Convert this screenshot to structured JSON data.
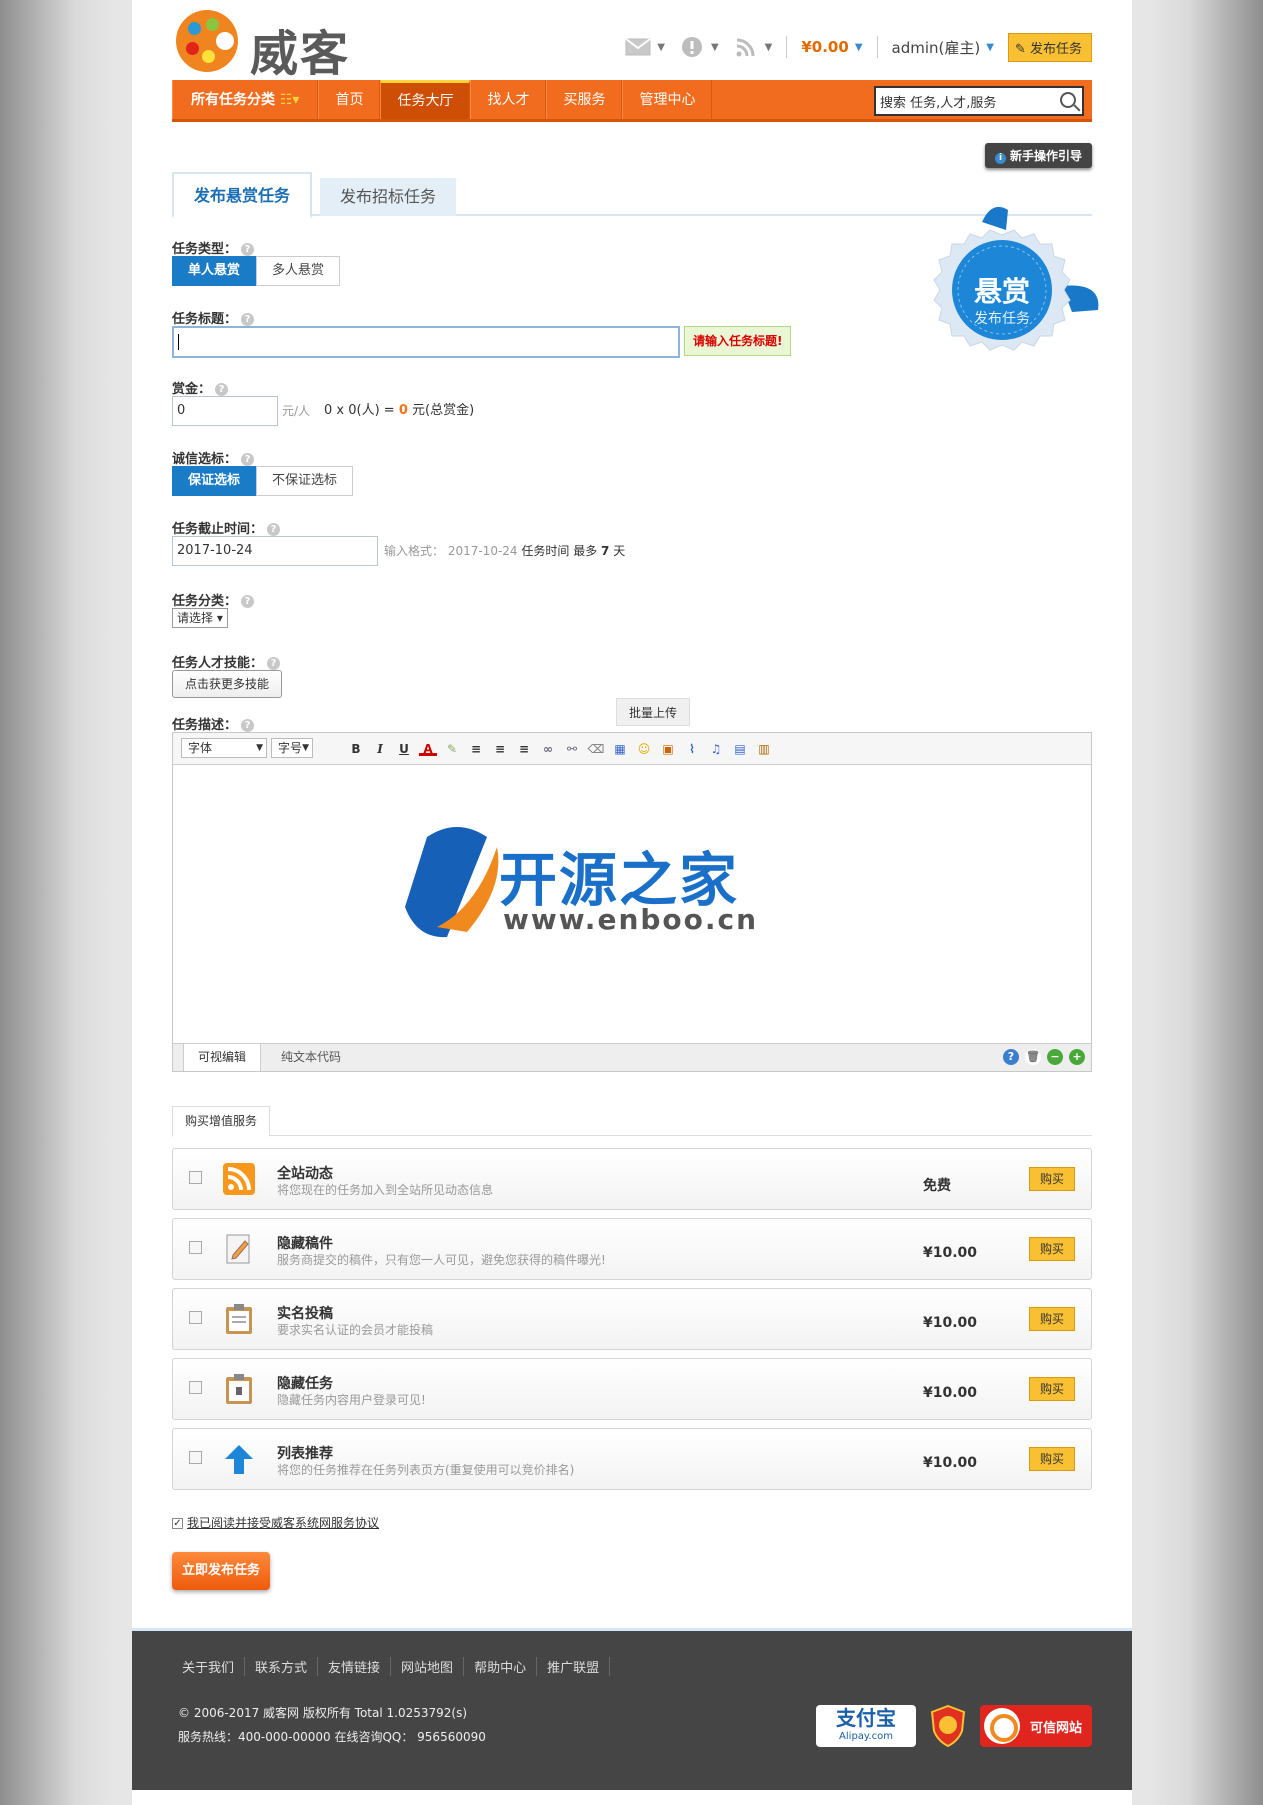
{
  "header": {
    "logo_text": "威客",
    "balance": "¥0.00",
    "user": "admin(雇主)",
    "post_task": "发布任务"
  },
  "nav": {
    "items": [
      "所有任务分类",
      "首页",
      "任务大厅",
      "找人才",
      "买服务",
      "管理中心"
    ],
    "active_index": 2,
    "search_value": "搜索 任务,人才,服务"
  },
  "guide_button": "新手操作引导",
  "tabs": [
    "发布悬赏任务",
    "发布招标任务"
  ],
  "badge": {
    "title": "悬赏",
    "subtitle": "发布任务"
  },
  "form": {
    "task_type": {
      "label": "任务类型：",
      "options": [
        "单人悬赏",
        "多人悬赏"
      ],
      "selected": 0
    },
    "title": {
      "label": "任务标题：",
      "value": "",
      "error": "请输入任务标题!"
    },
    "bounty": {
      "label": "赏金：",
      "value": "0",
      "unit": "元/人",
      "formula_pre": "0 x 0(人) = ",
      "formula_total": "0",
      "formula_post": " 元(总赏金)"
    },
    "bid": {
      "label": "诚信选标：",
      "options": [
        "保证选标",
        "不保证选标"
      ],
      "selected": 0
    },
    "deadline": {
      "label": "任务截止时间：",
      "value": "2017-10-24",
      "hint_pre": "输入格式：  2017-10-24",
      "hint_mid": " 任务时间 最多 ",
      "hint_days": "7",
      "hint_post": " 天"
    },
    "category": {
      "label": "任务分类：",
      "value": "请选择"
    },
    "skills": {
      "label": "任务人才技能：",
      "button": "点击获更多技能"
    },
    "description": {
      "label": "任务描述：",
      "batch_upload": "批量上传",
      "font": "字体",
      "size": "字号",
      "tab_visual": "可视编辑",
      "tab_source": "纯文本代码"
    }
  },
  "watermark": {
    "title": "开源之家",
    "url": "www.enboo.cn"
  },
  "value_added": {
    "tab": "购买增值服务",
    "buy_label": "购买",
    "items": [
      {
        "name": "全站动态",
        "desc": "将您现在的任务加入到全站所见动态信息",
        "price": "免费",
        "icon": "rss-icon"
      },
      {
        "name": "隐藏稿件",
        "desc": "服务商提交的稿件，只有您一人可见，避免您获得的稿件曝光!",
        "price": "¥10.00",
        "icon": "edit-doc-icon"
      },
      {
        "name": "实名投稿",
        "desc": "要求实名认证的会员才能投稿",
        "price": "¥10.00",
        "icon": "clipboard-icon"
      },
      {
        "name": "隐藏任务",
        "desc": "隐藏任务内容用户登录可见!",
        "price": "¥10.00",
        "icon": "lock-clipboard-icon"
      },
      {
        "name": "列表推荐",
        "desc": "将您的任务推荐在任务列表页方(重复使用可以竞价排名)",
        "price": "¥10.00",
        "icon": "arrow-up-icon"
      }
    ]
  },
  "agreement": "我已阅读并接受威客系统网服务协议",
  "submit": "立即发布任务",
  "footer": {
    "links": [
      "关于我们",
      "联系方式",
      "友情链接",
      "网站地图",
      "帮助中心",
      "推广联盟"
    ],
    "copyright": "© 2006-2017 威客网 版权所有 Total 1.0253792(s)",
    "hotline": "服务热线：400-000-00000 在线咨询QQ： 956560090",
    "alipay": "支付宝",
    "alipay_sub": "Alipay.com",
    "cred": "可信网站"
  }
}
